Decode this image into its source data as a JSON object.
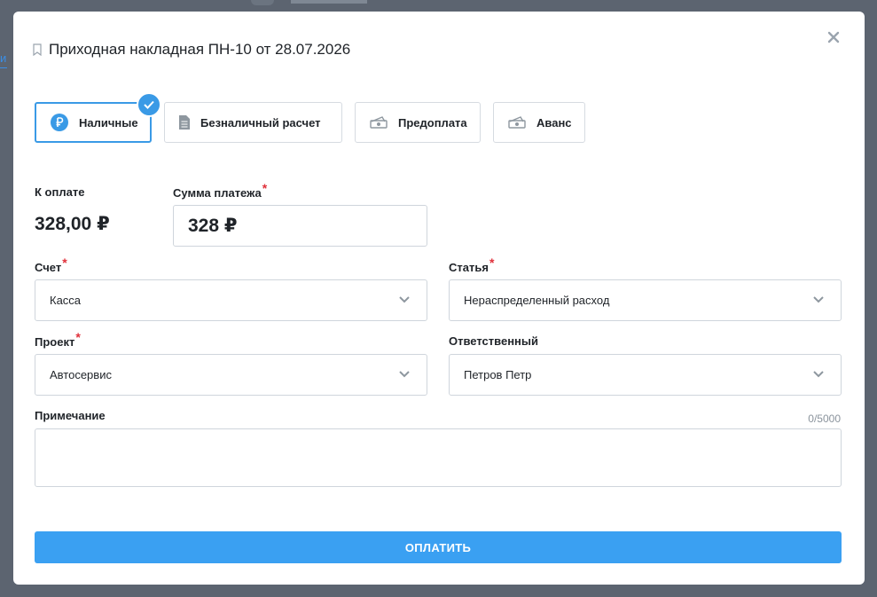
{
  "document": {
    "title": "Приходная накладная ПН-10 от 28.07.2026"
  },
  "payment_types": [
    {
      "label": "Наличные",
      "icon": "ruble-circle-icon",
      "selected": true
    },
    {
      "label": "Безналичный расчет",
      "icon": "document-icon",
      "selected": false
    },
    {
      "label": "Предоплата",
      "icon": "banknote-icon",
      "selected": false
    },
    {
      "label": "Аванс",
      "icon": "banknote-icon",
      "selected": false
    }
  ],
  "form": {
    "to_pay_label": "К оплате",
    "to_pay_value": "328,00 ₽",
    "payment_sum_label": "Сумма платежа",
    "payment_sum_value": "328 ₽",
    "account_label": "Счет",
    "account_value": "Касса",
    "article_label": "Статья",
    "article_value": "Нераспределенный расход",
    "project_label": "Проект",
    "project_value": "Автосервис",
    "responsible_label": "Ответственный",
    "responsible_value": "Петров Петр",
    "note_label": "Примечание",
    "note_counter": "0/5000",
    "required_mark": "*"
  },
  "actions": {
    "pay_label": "ОПЛАТИТЬ"
  },
  "colors": {
    "accent": "#3a9ae6",
    "button": "#3aa0f2",
    "required": "#e0303a"
  }
}
